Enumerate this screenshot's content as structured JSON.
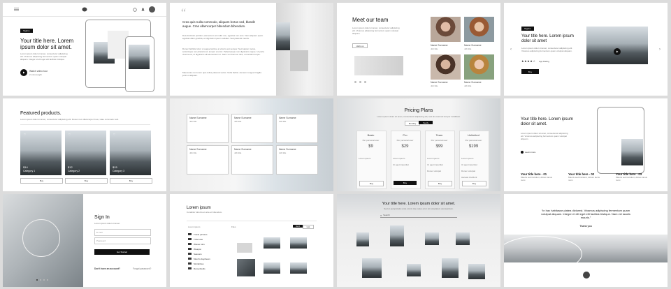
{
  "card1": {
    "tagline": "Tagline",
    "title": "Your title here. Lorem ipsum dolor sit amet.",
    "body": "Lorem ipsum dolor sit amet, consectetur adipiscing elit. Vivamus adipiscing fermentum quam volutpat aliquam. Integer et elit eget elit facilisis tristique.",
    "watch_label": "Watch video tour",
    "watch_sub": "2 mins length"
  },
  "card2": {
    "quote_mark": "“",
    "lead": "Cras quis nulla commodo, aliquam lectus sed, blandit augue. Cras ullamcorper bibendum bibendum.",
    "p1": "Duis tincidunt porttitor, elementum at mollis non, egestas nec eros. Nam aliquam quam egestas diam gravida, ac dignissim ipsum sodales. Sed placerat mauris.",
    "p2": "Donec facilisis tortor ut augue lacinia, at viverra est semper. Sed sapien metus, scelerisque nec pharetra id, tempor a tortor. Pellentesque non dignissim neque. Ut porta viverra est, ut dignissim elit elementum ut. Nunc vel rhoncus nibh, ut tincidunt turpis.",
    "p3": "Maecenas non lorem quis tellus placerat varius. Nulla facilisi. Aenean congue fringilla justo ut aliquam."
  },
  "card3": {
    "title": "Meet our team",
    "body": "Lorem ipsum dolor sit amet, consectetur adipiscing elit. Vivamus adipiscing fermentum quam volutpat aliquam.",
    "button": "Hello us",
    "members": [
      {
        "name": "Name Surname",
        "role": "Job title"
      },
      {
        "name": "Name Surname",
        "role": "Job title"
      },
      {
        "name": "Name Surname",
        "role": "Job title"
      },
      {
        "name": "Name Surname",
        "role": "Job title"
      }
    ]
  },
  "card4": {
    "tagline": "Tagline",
    "title": "Your title here. Lorem ipsum dolor sit amet",
    "body": "Lorem ipsum dolor sit amet, consectetur adipiscing elit. Vivamus adipiscing fermentum quam volutpat aliquam.",
    "rating_label": "App Rating",
    "buy": "Buy"
  },
  "card5": {
    "title": "Featured products.",
    "subtitle": "Lorem ipsum dolor sit amet, consectetur adipiscing elit. Donec nec ullamcorper risus, vitae commodo velit.",
    "products": [
      {
        "price": "$14",
        "category": "Category 1",
        "button": "Buy"
      },
      {
        "price": "$12",
        "category": "Category 2",
        "button": "Buy"
      },
      {
        "price": "$15",
        "category": "Category 3",
        "button": "Buy"
      }
    ]
  },
  "card6": {
    "people": [
      {
        "name": "Name Surname",
        "role": "Job title"
      },
      {
        "name": "Name Surname",
        "role": "Job title"
      },
      {
        "name": "Name Surname",
        "role": "Job title"
      },
      {
        "name": "Name Surname",
        "role": "Job title"
      },
      {
        "name": "Name Surname",
        "role": "Job title"
      },
      {
        "name": "Name Surname",
        "role": "Job title"
      }
    ]
  },
  "card7": {
    "title": "Pricing Plans",
    "subtitle": "Lorem ipsum dolor sit amet, consectetur adipiscing elit, sed do eiusmod tempor incididunt.",
    "toggle": [
      "Monthly",
      "Yearly"
    ],
    "plans": [
      {
        "name": "Basic",
        "period": "Per personal user",
        "price": "$9",
        "features": [
          "Lorem ipsum"
        ],
        "button": "Buy"
      },
      {
        "name": "Pro",
        "period": "Per personal user",
        "price": "$29",
        "features": [
          "Lorem ipsum",
          "Ut eget imperdiet"
        ],
        "button": "Buy"
      },
      {
        "name": "Team",
        "period": "Per personal user",
        "price": "$99",
        "features": [
          "Lorem ipsum",
          "Ut eget imperdiet",
          "Donec volutpat"
        ],
        "button": "Buy"
      },
      {
        "name": "Unlimited",
        "period": "Per personal user",
        "price": "$199",
        "features": [
          "Lorem ipsum",
          "Ut eget imperdiet",
          "Donec volutpat",
          "Aenean tincidunt"
        ],
        "button": "Buy"
      }
    ]
  },
  "card8": {
    "title": "Your title here. Lorem ipsum dolor sit amet.",
    "body": "Lorem ipsum dolor sit amet, consectetur adipiscing elit. Vivamus adipiscing fermentum quam volutpat aliquam.",
    "learn_more": "Learn more",
    "features": [
      {
        "title": "Your title here - 01",
        "body": "Mauris sed tincidunt, dictum lacus nunc."
      },
      {
        "title": "Your title here - 02",
        "body": "Mauris sed tincidunt, dictum lacus nunc."
      },
      {
        "title": "Your title here - 03",
        "body": "Mauris sed tincidunt, dictum lacus nunc."
      }
    ]
  },
  "card9": {
    "title": "Sign In",
    "subtitle": "Lorem ipsum dolor sit amet.",
    "email_placeholder": "E-mail",
    "password_placeholder": "Password",
    "submit": "Get Started",
    "no_account": "Don't have an account?",
    "forgot": "Forgot password?"
  },
  "card10": {
    "title": "Lorem ipsum",
    "subtitle": "Curabitur lobortis et ante et bibendum.",
    "section_left": "Lorem ipsum",
    "section_right": "Files",
    "view_toggle": [
      "Grid",
      "List"
    ],
    "folders": [
      "Travel pictures",
      "Tribe lane",
      "Waves runs",
      "Weapon",
      "Seasons",
      "Mauri's daydream",
      "Similarities",
      "Ramenfields"
    ]
  },
  "card11": {
    "title": "Your title here. Lorem ipsum dolor sit amet.",
    "subtitle": "Sed ut perspiciatis unde omnis iste natus error sit voluptatem accusantium.",
    "search_label": "Search"
  },
  "card12": {
    "quote": "“In hac habitasse platea dictumst. Vivamus adipiscing fermentum quam volutpat aliquam. Integer et elit eget elit facilisis tristique. Nam vel iaculis mauris.”",
    "thanks": "Thank you"
  }
}
